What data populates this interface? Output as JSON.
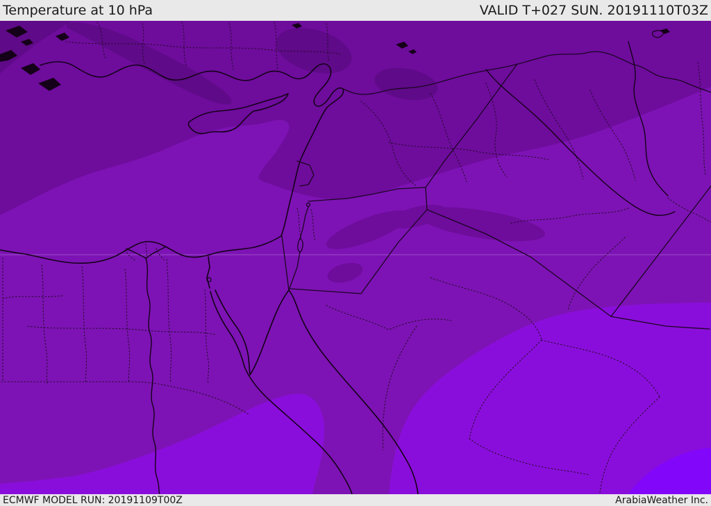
{
  "header": {
    "title": "Temperature at 10 hPa",
    "valid": "VALID T+027 SUN. 20191110T03Z"
  },
  "footer": {
    "model_run": "ECMWF MODEL RUN: 20191109T00Z",
    "credit": "ArabiaWeather Inc."
  },
  "map": {
    "description": "ECMWF temperature contour field at 10 hPa over the Middle East",
    "colors": {
      "band_coldest": "#5f0a88",
      "band_cold": "#6e0c9c",
      "band_mid": "#7d13b4",
      "band_warm": "#8a0edb",
      "band_warmest": "#8206f9",
      "coastline": "#140018",
      "border": "#1b0522",
      "dotted_border": "#2a0b33",
      "gridline": "rgba(255,255,255,0.25)",
      "bar_background": "#e9e9e9",
      "bar_text": "#1a1a1a"
    }
  }
}
